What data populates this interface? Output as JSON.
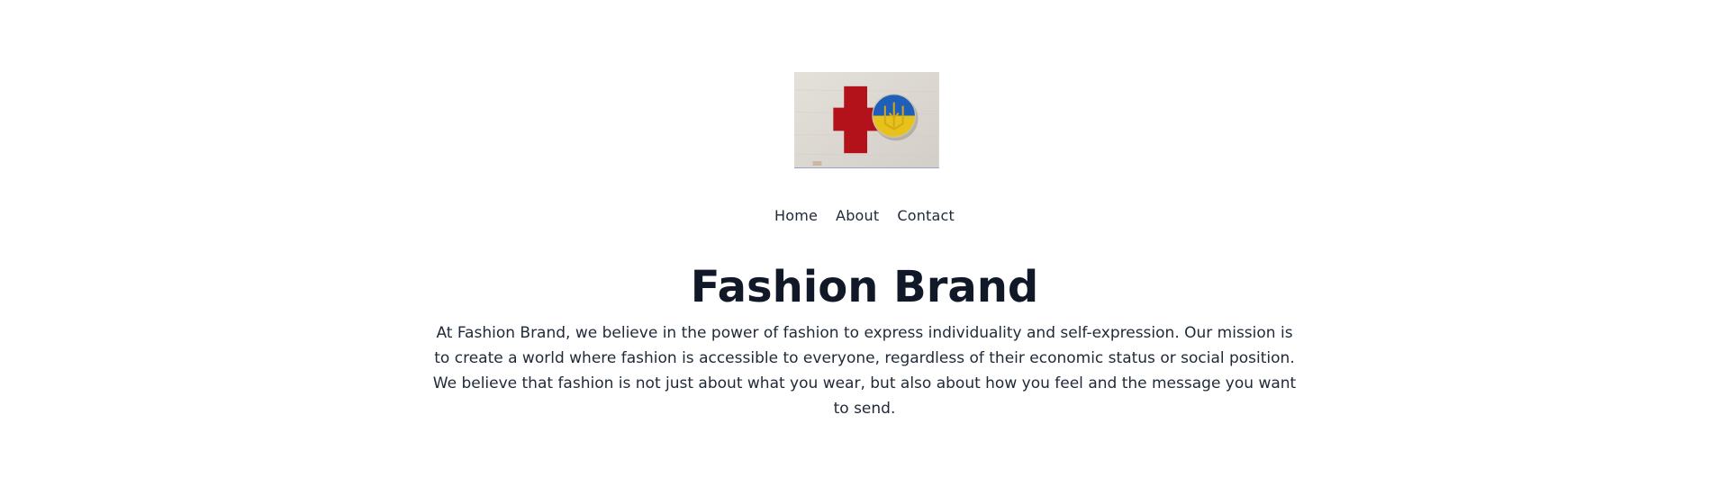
{
  "hero": {
    "icon": "red-cross-ukraine-badge-icon",
    "colors": {
      "cross": "#b3121a",
      "badge_blue": "#1f5fb8",
      "badge_yellow": "#e6c21a",
      "fabric": "#dedad4"
    }
  },
  "nav": {
    "items": [
      {
        "label": "Home"
      },
      {
        "label": "About"
      },
      {
        "label": "Contact"
      }
    ]
  },
  "main": {
    "title": "Fashion Brand",
    "mission": "At Fashion Brand, we believe in the power of fashion to express individuality and self-expression. Our mission is to create a world where fashion is accessible to everyone, regardless of their economic status or social position. We believe that fashion is not just about what you wear, but also about how you feel and the message you want to send."
  }
}
